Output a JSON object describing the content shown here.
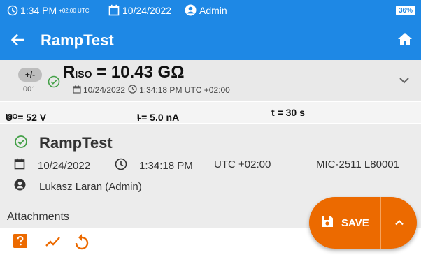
{
  "status_bar": {
    "time": "1:34 PM",
    "utc_offset": "+02:00 UTC",
    "date": "10/24/2022",
    "user": "Admin",
    "battery": "36%"
  },
  "app_bar": {
    "title": "RampTest"
  },
  "result": {
    "sign_toggle": "+/-",
    "number": "001",
    "symbol": "R",
    "symbol_sub": "ISO",
    "value_text": " = 10.43 GΩ",
    "date": "10/24/2022",
    "time": "1:34:18 PM",
    "timezone": "UTC +02:00"
  },
  "params": {
    "u_iso_symbol": "U",
    "u_iso_sub": "ISO",
    "u_iso_value": " = 52 V",
    "i_l_symbol": "I",
    "i_l_sub": "L",
    "i_l_value": " = 5.0 nA",
    "t_value": "t = 30 s"
  },
  "measurement": {
    "name": "RampTest",
    "date": "10/24/2022",
    "time": "1:34:18 PM",
    "timezone": "UTC +02:00",
    "device": "MIC-2511 L80001",
    "operator": "Lukasz Laran (Admin)"
  },
  "attachments": {
    "label": "Attachments"
  },
  "actions": {
    "save_label": "SAVE"
  },
  "colors": {
    "primary": "#1e88e5",
    "accent": "#ec6a00",
    "ok_green": "#43a047"
  }
}
